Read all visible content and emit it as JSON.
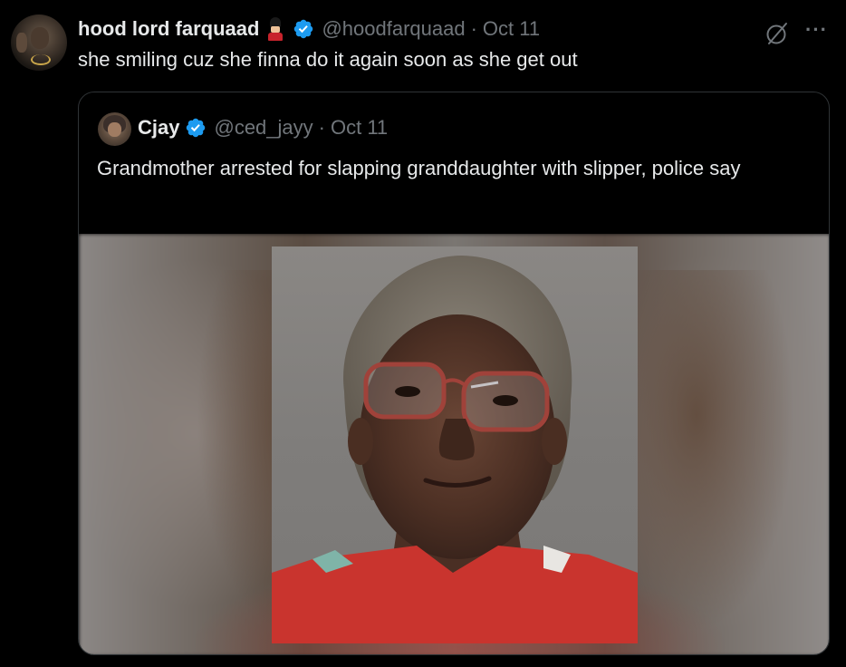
{
  "tweet": {
    "display_name": "hood lord farquaad",
    "handle": "@hoodfarquaad",
    "separator": "·",
    "date": "Oct 11",
    "text": "she smiling cuz she finna do it again soon as she get out",
    "more_glyph": "···"
  },
  "quoted": {
    "display_name": "Cjay",
    "handle": "@ced_jayy",
    "separator": "·",
    "date": "Oct 11",
    "text": "Grandmother arrested for slapping granddaughter with slipper, police say"
  },
  "colors": {
    "background": "#000000",
    "text": "#e7e9ea",
    "muted": "#71767b",
    "verified_blue": "#1d9bf0",
    "border": "#2f3336"
  },
  "icons": {
    "verified": "verified-badge-icon",
    "grok": "grok-icon",
    "more": "more-options-icon",
    "emoji": "guardsman-emoji-icon"
  }
}
